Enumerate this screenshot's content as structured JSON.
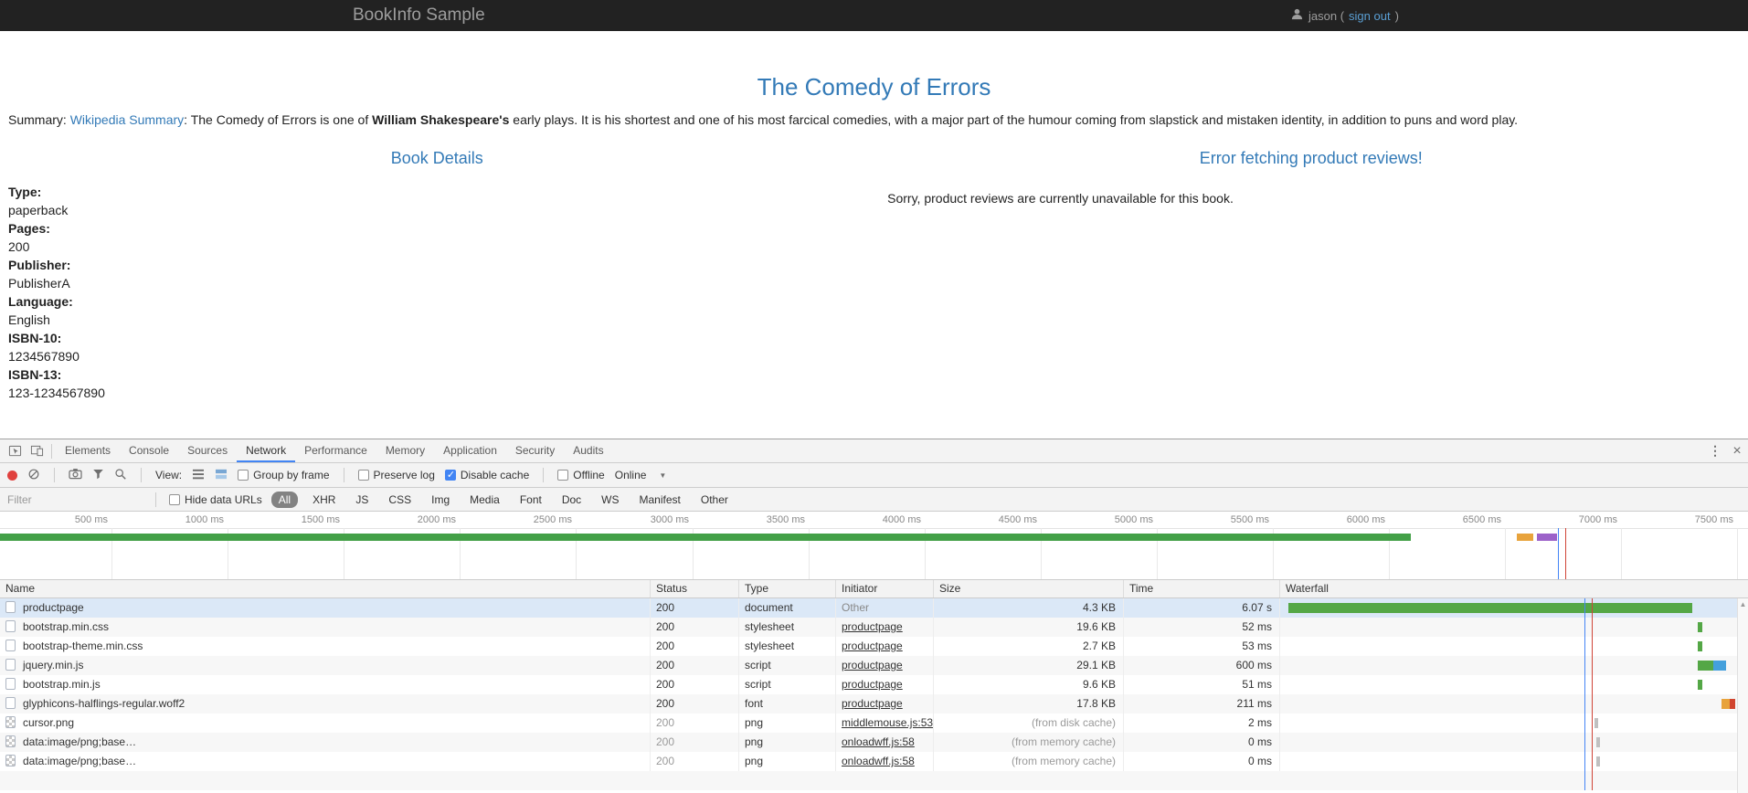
{
  "colors": {
    "accent_blue": "#337ab7",
    "app_header_bg": "#222222",
    "devtools_bar_bg": "#f3f3f3",
    "record_red": "#e0413e",
    "checkbox_blue": "#4285f4",
    "waterfall_green": "#54a746",
    "waterfall_blue": "#44a0dc",
    "waterfall_orange": "#e8a33c",
    "waterfall_red": "#d1452f",
    "selected_row_bg": "#dbe8f7"
  },
  "app": {
    "brand": "BookInfo Sample",
    "user_prefix": "jason (",
    "signout": "sign out",
    "user_suffix": ")"
  },
  "book": {
    "title": "The Comedy of Errors",
    "summary_label": "Summary: ",
    "summary_link": "Wikipedia Summary",
    "summary_mid": ": The Comedy of Errors is one of ",
    "summary_bold": "William Shakespeare's",
    "summary_rest": " early plays. It is his shortest and one of his most farcical comedies, with a major part of the humour coming from slapstick and mistaken identity, in addition to puns and word play.",
    "details_heading": "Book Details",
    "fields": [
      {
        "label": "Type:",
        "value": "paperback"
      },
      {
        "label": "Pages:",
        "value": "200"
      },
      {
        "label": "Publisher:",
        "value": "PublisherA"
      },
      {
        "label": "Language:",
        "value": "English"
      },
      {
        "label": "ISBN-10:",
        "value": "1234567890"
      },
      {
        "label": "ISBN-13:",
        "value": "123-1234567890"
      }
    ],
    "reviews_heading": "Error fetching product reviews!",
    "reviews_message": "Sorry, product reviews are currently unavailable for this book."
  },
  "devtools": {
    "tabs": [
      "Elements",
      "Console",
      "Sources",
      "Network",
      "Performance",
      "Memory",
      "Application",
      "Security",
      "Audits"
    ],
    "active_tab": "Network",
    "toolbar": {
      "view_label": "View:",
      "group_by_frame": "Group by frame",
      "preserve_log": "Preserve log",
      "disable_cache": "Disable cache",
      "offline": "Offline",
      "throttling": "Online"
    },
    "filterbar": {
      "filter_placeholder": "Filter",
      "hide_data_urls": "Hide data URLs",
      "active_pill": "All",
      "pills": [
        "All",
        "XHR",
        "JS",
        "CSS",
        "Img",
        "Media",
        "Font",
        "Doc",
        "WS",
        "Manifest",
        "Other"
      ]
    },
    "timeline_ticks": [
      "500 ms",
      "1000 ms",
      "1500 ms",
      "2000 ms",
      "2500 ms",
      "3000 ms",
      "3500 ms",
      "4000 ms",
      "4500 ms",
      "5000 ms",
      "5500 ms",
      "6000 ms",
      "6500 ms",
      "7000 ms",
      "7500 ms"
    ],
    "columns": [
      "Name",
      "Status",
      "Type",
      "Initiator",
      "Size",
      "Time",
      "Waterfall"
    ],
    "requests": [
      {
        "name": "productpage",
        "status": "200",
        "type": "document",
        "initiator": "Other",
        "size": "4.3 KB",
        "time": "6.07 s"
      },
      {
        "name": "bootstrap.min.css",
        "status": "200",
        "type": "stylesheet",
        "initiator": "productpage",
        "size": "19.6 KB",
        "time": "52 ms"
      },
      {
        "name": "bootstrap-theme.min.css",
        "status": "200",
        "type": "stylesheet",
        "initiator": "productpage",
        "size": "2.7 KB",
        "time": "53 ms"
      },
      {
        "name": "jquery.min.js",
        "status": "200",
        "type": "script",
        "initiator": "productpage",
        "size": "29.1 KB",
        "time": "600 ms"
      },
      {
        "name": "bootstrap.min.js",
        "status": "200",
        "type": "script",
        "initiator": "productpage",
        "size": "9.6 KB",
        "time": "51 ms"
      },
      {
        "name": "glyphicons-halflings-regular.woff2",
        "status": "200",
        "type": "font",
        "initiator": "productpage",
        "size": "17.8 KB",
        "time": "211 ms"
      },
      {
        "name": "cursor.png",
        "status": "200",
        "type": "png",
        "initiator": "middlemouse.js:53",
        "size": "(from disk cache)",
        "time": "2 ms"
      },
      {
        "name": "data:image/png;base…",
        "status": "200",
        "type": "png",
        "initiator": "onloadwff.js:58",
        "size": "(from memory cache)",
        "time": "0 ms"
      },
      {
        "name": "data:image/png;base…",
        "status": "200",
        "type": "png",
        "initiator": "onloadwff.js:58",
        "size": "(from memory cache)",
        "time": "0 ms"
      }
    ]
  }
}
